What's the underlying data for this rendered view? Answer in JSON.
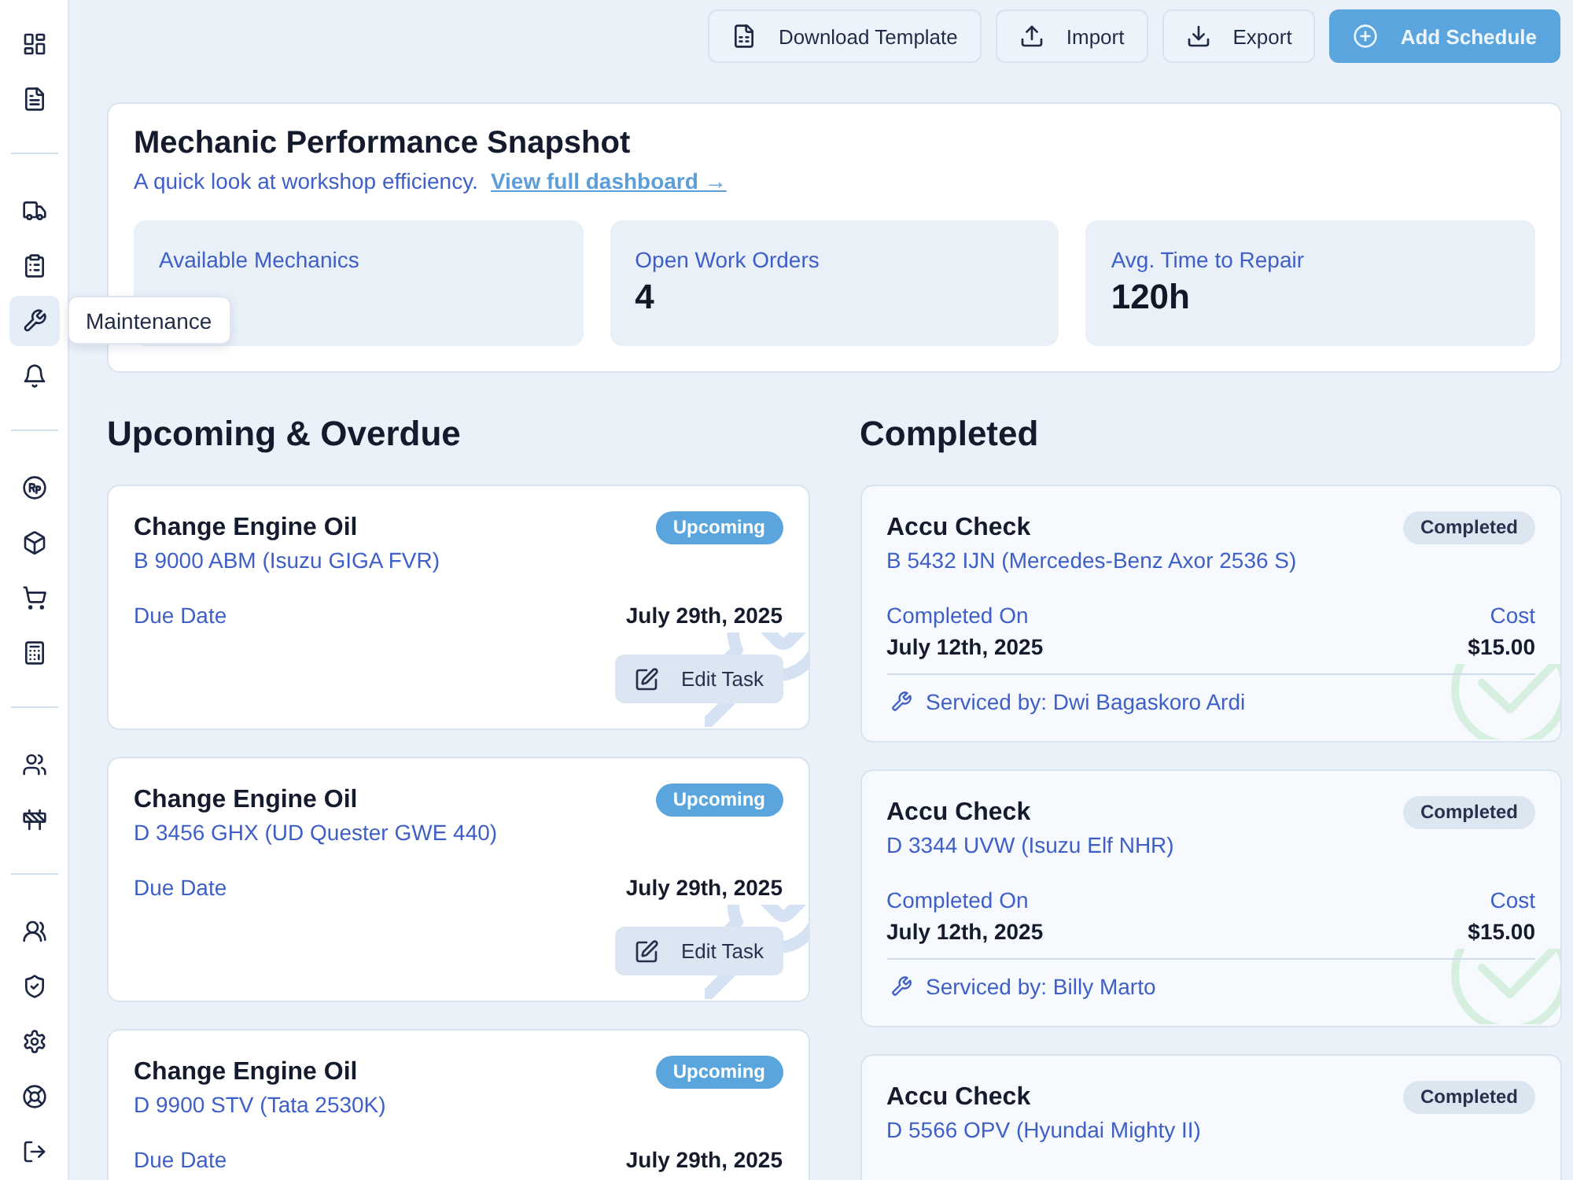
{
  "sidebar": {
    "groups": [
      {
        "items": [
          {
            "selected": false
          },
          {
            "selected": false
          }
        ]
      },
      {
        "items": [
          {
            "selected": false
          },
          {
            "selected": false
          },
          {
            "selected": true,
            "tooltip": "Maintenance"
          },
          {
            "selected": false
          }
        ]
      },
      {
        "items": [
          {
            "selected": false
          },
          {
            "selected": false
          },
          {
            "selected": false
          },
          {
            "selected": false
          }
        ]
      },
      {
        "items": [
          {
            "selected": false
          },
          {
            "selected": false
          }
        ]
      },
      {
        "items": [
          {
            "selected": false
          },
          {
            "selected": false
          },
          {
            "selected": false
          },
          {
            "selected": false
          },
          {
            "selected": false
          }
        ]
      }
    ]
  },
  "toolbar": [
    {
      "label": "Download Template",
      "kind": "secondary"
    },
    {
      "label": "Import",
      "kind": "secondary"
    },
    {
      "label": "Export",
      "kind": "secondary"
    },
    {
      "label": "Add Schedule",
      "kind": "primary"
    }
  ],
  "snapshot": {
    "title": "Mechanic Performance Snapshot",
    "subtitle": "A quick look at workshop efficiency.",
    "link": "View full dashboard →",
    "stats": [
      {
        "label": "Available Mechanics"
      },
      {
        "label": "Open Work Orders",
        "value": "4"
      },
      {
        "label": "Avg. Time to Repair",
        "value": "120h"
      }
    ]
  },
  "upcoming": {
    "title": "Upcoming & Overdue",
    "tasks": [
      {
        "title": "Change Engine Oil",
        "vehicle": "B 9000 ABM (Isuzu GIGA FVR)",
        "badge": {
          "text": "Upcoming",
          "kind": "upcoming"
        },
        "due_label": "Due Date",
        "due_date": "July 29th, 2025",
        "action": "Edit Task"
      },
      {
        "title": "Change Engine Oil",
        "vehicle": "D 3456 GHX (UD Quester GWE 440)",
        "badge": {
          "text": "Upcoming",
          "kind": "upcoming"
        },
        "due_label": "Due Date",
        "due_date": "July 29th, 2025",
        "action": "Edit Task"
      },
      {
        "title": "Change Engine Oil",
        "vehicle": "D 9900 STV (Tata 2530K)",
        "badge": {
          "text": "Upcoming",
          "kind": "upcoming"
        },
        "due_label": "Due Date",
        "due_date": "July 29th, 2025"
      }
    ]
  },
  "completed": {
    "title": "Completed",
    "tasks": [
      {
        "title": "Accu Check",
        "vehicle": "B 5432 IJN (Mercedes-Benz Axor 2536 S)",
        "badge": {
          "text": "Completed",
          "kind": "completed"
        },
        "completed_label": "Completed On",
        "completed_on": "July 12th, 2025",
        "cost_label": "Cost",
        "cost": "$15.00",
        "serviced_by": "Serviced by: Dwi Bagaskoro Ardi"
      },
      {
        "title": "Accu Check",
        "vehicle": "D 3344 UVW (Isuzu Elf NHR)",
        "badge": {
          "text": "Completed",
          "kind": "completed"
        },
        "completed_label": "Completed On",
        "completed_on": "July 12th, 2025",
        "cost_label": "Cost",
        "cost": "$15.00",
        "serviced_by": "Serviced by: Billy Marto"
      },
      {
        "title": "Accu Check",
        "vehicle": "D 5566 OPV (Hyundai Mighty II)",
        "badge": {
          "text": "Completed",
          "kind": "completed"
        }
      }
    ]
  }
}
